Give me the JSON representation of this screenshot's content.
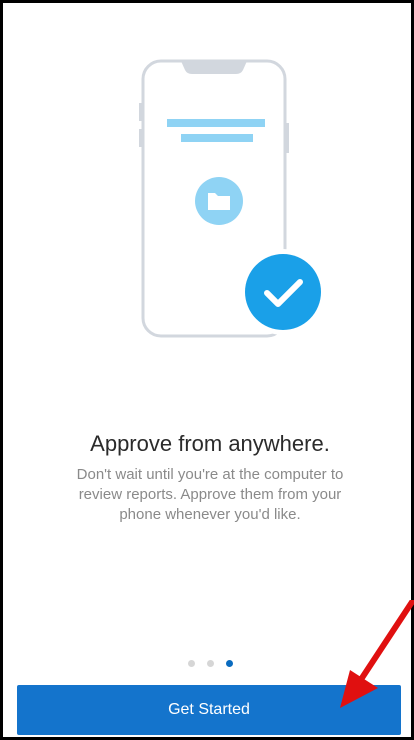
{
  "onboarding": {
    "headline": "Approve from anywhere.",
    "body": "Don't wait until you're at the computer to review reports. Approve them from your phone whenever you'd like.",
    "pager": {
      "total": 3,
      "current": 3
    },
    "cta_label": "Get Started"
  },
  "colors": {
    "accent": "#1474cc",
    "light_blue": "#8fd3f4",
    "check_blue": "#1aa0e8",
    "annotation_red": "#e01010"
  },
  "icons": [
    "phone-illustration",
    "folder-icon",
    "checkmark-icon",
    "annotation-arrow-icon"
  ]
}
